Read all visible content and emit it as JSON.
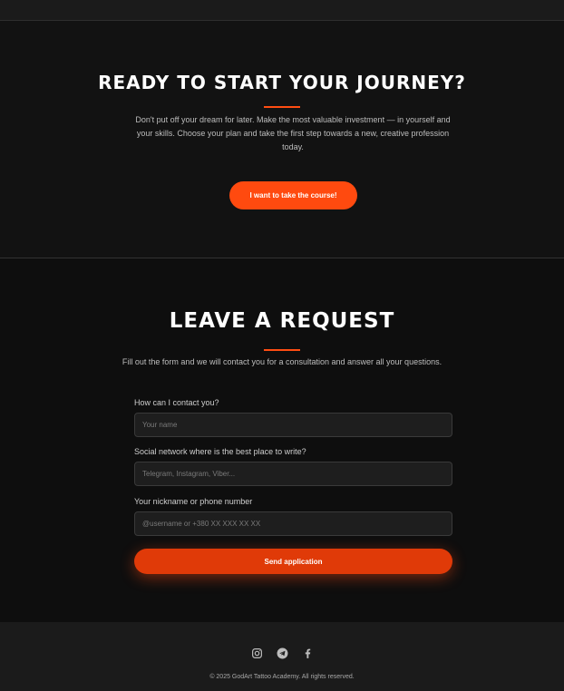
{
  "cta": {
    "title": "READY TO START YOUR JOURNEY?",
    "text": "Don't put off your dream for later. Make the most valuable investment — in yourself and your skills. Choose your plan and take the first step towards a new, creative profession today.",
    "button_label": "I want to take the course!"
  },
  "form": {
    "title": "LEAVE A REQUEST",
    "subtitle": "Fill out the form and we will contact you for a consultation and answer all your questions.",
    "fields": [
      {
        "label": "How can I contact you?",
        "placeholder": "Your name",
        "value": ""
      },
      {
        "label": "Social network where is the best place to write?",
        "placeholder": "Telegram, Instagram, Viber...",
        "value": ""
      },
      {
        "label": "Your nickname or phone number",
        "placeholder": "@username or +380 XX XXX XX XX",
        "value": ""
      }
    ],
    "submit_label": "Send application"
  },
  "footer": {
    "social_icons": [
      "instagram-icon",
      "telegram-icon",
      "facebook-icon"
    ],
    "copyright": "© 2025 GodArt Tattoo Academy. All rights reserved."
  },
  "colors": {
    "accent": "#ff4a0f",
    "background": "#121212",
    "footer_background": "#1b1b1b"
  }
}
